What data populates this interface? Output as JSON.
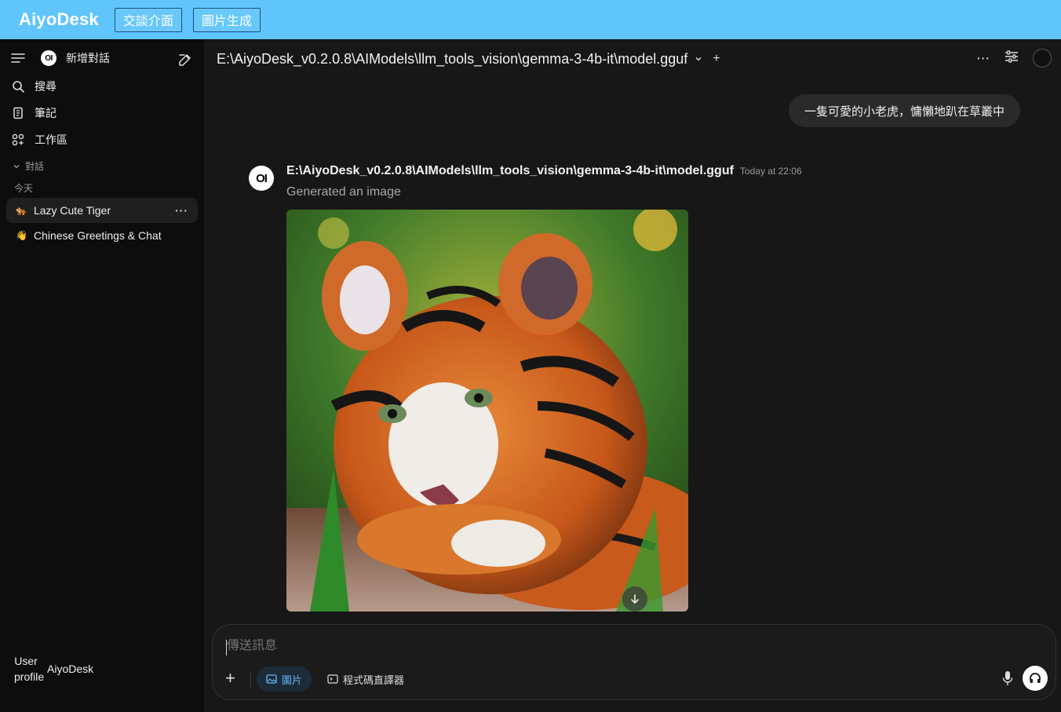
{
  "app": {
    "title": "AiyoDesk",
    "tabs": [
      "交談介面",
      "圖片生成"
    ],
    "accent_color": "#5fc5fb"
  },
  "sidebar": {
    "new_chat_label": "新增對話",
    "nav": [
      {
        "label": "搜尋",
        "icon": "search-icon"
      },
      {
        "label": "筆記",
        "icon": "notes-icon"
      },
      {
        "label": "工作區",
        "icon": "workspace-icon"
      }
    ],
    "section_label": "對話",
    "group_label": "今天",
    "chats": [
      {
        "emoji": "🐅",
        "title": "Lazy Cute Tiger"
      },
      {
        "emoji": "👋",
        "title": "Chinese Greetings & Chat"
      }
    ],
    "user": {
      "avatar_alt": "User profile",
      "name": "AiyoDesk"
    }
  },
  "header": {
    "model_path": "E:\\AiyoDesk_v0.2.0.8\\AIModels\\llm_tools_vision\\gemma-3-4b-it\\model.gguf",
    "plus": "+"
  },
  "messages": {
    "user_text": "一隻可愛的小老虎，慵懶地趴在草叢中",
    "assistant": {
      "avatar": "OI",
      "name": "E:\\AiyoDesk_v0.2.0.8\\AIModels\\llm_tools_vision\\gemma-3-4b-it\\model.gguf",
      "time": "Today at 22:06",
      "status": "Generated an image"
    }
  },
  "composer": {
    "placeholder": "傳送訊息",
    "image_pill": "圖片",
    "code_pill": "程式碼直譯器"
  }
}
